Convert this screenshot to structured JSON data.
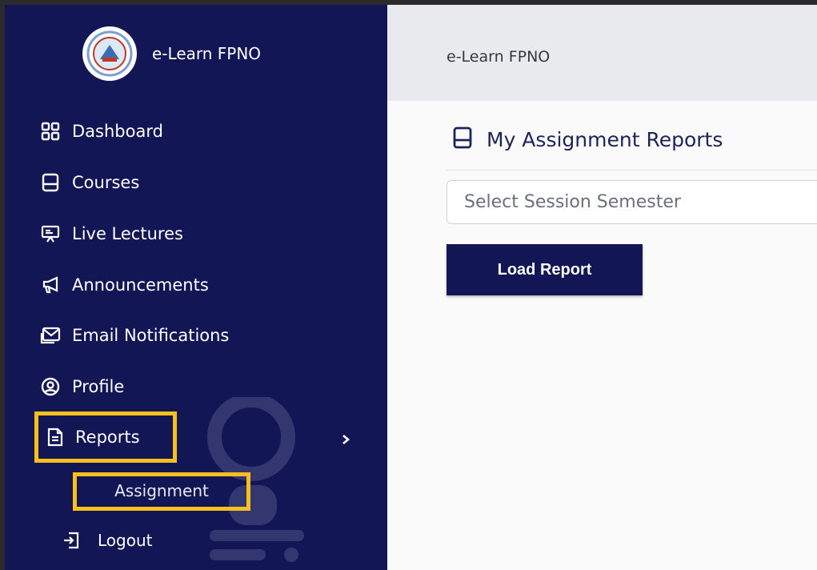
{
  "app": {
    "name": "e-Learn FPNO"
  },
  "topbar": {
    "title": "e-Learn FPNO"
  },
  "sidebar": {
    "items": [
      {
        "label": "Dashboard",
        "icon": "dashboard-grid-icon"
      },
      {
        "label": "Courses",
        "icon": "book-icon"
      },
      {
        "label": "Live Lectures",
        "icon": "presentation-board-icon"
      },
      {
        "label": "Announcements",
        "icon": "megaphone-icon"
      },
      {
        "label": "Email Notifications",
        "icon": "envelope-icon"
      },
      {
        "label": "Profile",
        "icon": "user-circle-icon"
      },
      {
        "label": "Reports",
        "icon": "report-document-icon"
      }
    ],
    "submenu": {
      "label": "Assignment"
    },
    "logout": {
      "label": "Logout",
      "icon": "logout-icon"
    }
  },
  "main": {
    "title": "My Assignment Reports",
    "select_placeholder": "Select Session Semester",
    "load_button": "Load Report"
  },
  "colors": {
    "sidebar": "#131654",
    "highlight": "#f9c01c",
    "topbar": "#e8eaee"
  }
}
